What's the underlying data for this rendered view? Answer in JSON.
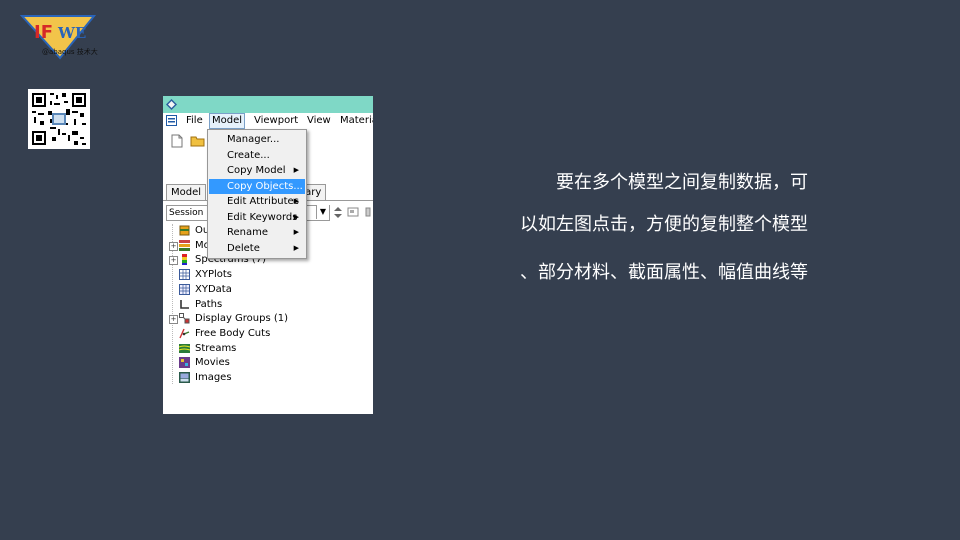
{
  "logo": {
    "main_text": "IFWE",
    "sub_text": "@abaqus 技术大"
  },
  "window": {
    "menubar": [
      "File",
      "Model",
      "Viewport",
      "View",
      "Materia"
    ],
    "tabs": [
      "Model",
      "rary"
    ],
    "combo_value": "Session D"
  },
  "dropdown": {
    "items": [
      {
        "label": "Manager...",
        "submenu": false
      },
      {
        "label": "Create...",
        "submenu": false
      },
      {
        "label": "Copy Model",
        "submenu": true
      },
      {
        "label": "Copy Objects...",
        "submenu": false,
        "highlighted": true
      },
      {
        "label": "Edit Attributes",
        "submenu": true
      },
      {
        "label": "Edit Keywords",
        "submenu": true
      },
      {
        "label": "Rename",
        "submenu": true
      },
      {
        "label": "Delete",
        "submenu": true
      }
    ]
  },
  "tree": [
    {
      "label": "Ou",
      "expandable": false,
      "icon": "output-db-icon"
    },
    {
      "label": "Mo",
      "expandable": true,
      "icon": "model-stack-icon"
    },
    {
      "label": "Spectrums (7)",
      "expandable": true,
      "icon": "spectrum-icon"
    },
    {
      "label": "XYPlots",
      "expandable": false,
      "icon": "xyplot-icon"
    },
    {
      "label": "XYData",
      "expandable": false,
      "icon": "xydata-icon"
    },
    {
      "label": "Paths",
      "expandable": false,
      "icon": "path-icon"
    },
    {
      "label": "Display Groups (1)",
      "expandable": true,
      "icon": "display-group-icon"
    },
    {
      "label": "Free Body Cuts",
      "expandable": false,
      "icon": "free-body-icon"
    },
    {
      "label": "Streams",
      "expandable": false,
      "icon": "streams-icon"
    },
    {
      "label": "Movies",
      "expandable": false,
      "icon": "movies-icon"
    },
    {
      "label": "Images",
      "expandable": false,
      "icon": "images-icon"
    }
  ],
  "description": [
    "要在多个模型之间复制数据，可",
    "以如左图点击，方便的复制整个模型",
    "、部分材料、截面属性、幅值曲线等"
  ],
  "colors": {
    "background": "#353f4f",
    "titlebar": "#7fd8c6",
    "highlight": "#3399ff"
  }
}
